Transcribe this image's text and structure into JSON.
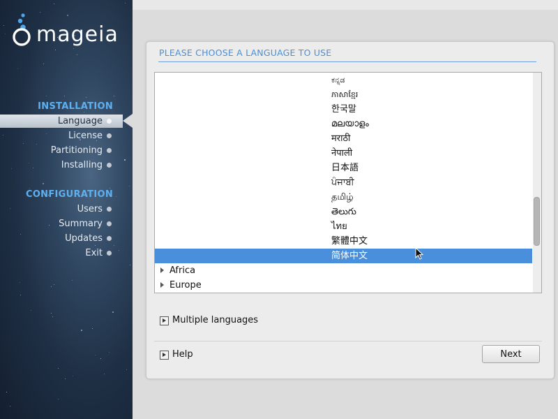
{
  "app": {
    "logo_text": "mageia"
  },
  "sidebar": {
    "sections": [
      {
        "title": "INSTALLATION",
        "steps": [
          {
            "label": "Language",
            "active": true
          },
          {
            "label": "License",
            "active": false
          },
          {
            "label": "Partitioning",
            "active": false
          },
          {
            "label": "Installing",
            "active": false
          }
        ]
      },
      {
        "title": "CONFIGURATION",
        "steps": [
          {
            "label": "Users",
            "active": false
          },
          {
            "label": "Summary",
            "active": false
          },
          {
            "label": "Updates",
            "active": false
          },
          {
            "label": "Exit",
            "active": false
          }
        ]
      }
    ]
  },
  "panel": {
    "title": "PLEASE CHOOSE A LANGUAGE TO USE",
    "languages": [
      "ಕನ್ನಡ",
      "ភាសាខ្មែរ",
      "한국말",
      "മലയാളം",
      "मराठी",
      "नेपाली",
      "日本語",
      "ਪੰਜਾਬੀ",
      "தமிழ்",
      "తెలుగు",
      "ไทย",
      "繁體中文",
      "简体中文"
    ],
    "selected_language": "简体中文",
    "groups": [
      "Africa",
      "Europe"
    ],
    "multiple_languages_label": "Multiple languages",
    "help_label": "Help",
    "next_label": "Next"
  },
  "colors": {
    "accent": "#4a8fdb",
    "section_title": "#5fb0f0",
    "panel_title": "#4a8fd8"
  }
}
